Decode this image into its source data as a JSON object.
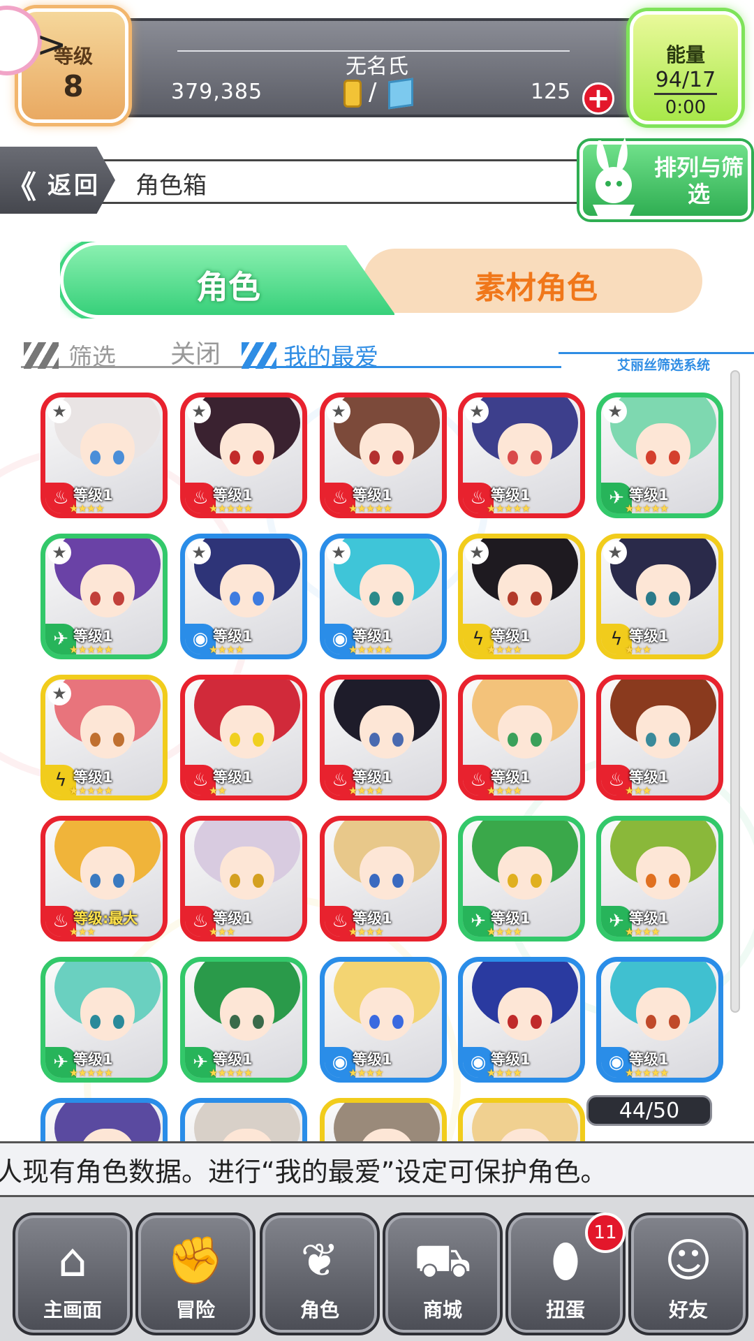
{
  "status": {
    "level_label": "等级",
    "level_value": "8",
    "username": "无名氏",
    "gold": "379,385",
    "currency_separator": "/",
    "gems": "125",
    "add_symbol": "+",
    "energy_label": "能量",
    "energy_value": "94/17",
    "energy_timer": "0:00",
    "collapse_symbol": ">"
  },
  "header": {
    "back_icon": "《",
    "back_label": "返回",
    "title": "角色箱",
    "sort_filter_label": "排列与筛选"
  },
  "tabs": {
    "characters": "角色",
    "materials": "素材角色"
  },
  "filter_row": {
    "filter_label": "筛选",
    "filter_state": "关闭",
    "favorites_label": "我的最爱",
    "system_caption": "艾丽丝筛选系统"
  },
  "box_count": "44/50",
  "grid": {
    "cards": [
      {
        "frame": "red",
        "element_icon": "fire-icon",
        "element_glyph": "♨",
        "favorite": true,
        "level": "等级1",
        "rarity": 4,
        "hair": "#e9e4e4",
        "eye": "#4b8ed8"
      },
      {
        "frame": "red",
        "element_icon": "fire-icon",
        "element_glyph": "♨",
        "favorite": true,
        "level": "等级1",
        "rarity": 5,
        "hair": "#3a2230",
        "eye": "#c22a2a"
      },
      {
        "frame": "red",
        "element_icon": "fire-icon",
        "element_glyph": "♨",
        "favorite": true,
        "level": "等级1",
        "rarity": 5,
        "hair": "#7c4a3a",
        "eye": "#b43030"
      },
      {
        "frame": "red",
        "element_icon": "fire-icon",
        "element_glyph": "♨",
        "favorite": true,
        "level": "等级1",
        "rarity": 5,
        "hair": "#3d3f8c",
        "eye": "#d94a4a"
      },
      {
        "frame": "green",
        "element_icon": "wind-icon",
        "element_glyph": "✈",
        "favorite": true,
        "level": "等级1",
        "rarity": 5,
        "hair": "#7ed8b0",
        "eye": "#d4402e"
      },
      {
        "frame": "green",
        "element_icon": "wind-icon",
        "element_glyph": "✈",
        "favorite": true,
        "level": "等级1",
        "rarity": 5,
        "hair": "#6a42a6",
        "eye": "#c2403a"
      },
      {
        "frame": "blue",
        "element_icon": "water-icon",
        "element_glyph": "◉",
        "favorite": true,
        "level": "等级1",
        "rarity": 4,
        "hair": "#2e3478",
        "eye": "#3e7ce0"
      },
      {
        "frame": "blue",
        "element_icon": "water-icon",
        "element_glyph": "◉",
        "favorite": true,
        "level": "等级1",
        "rarity": 5,
        "hair": "#3fc5d8",
        "eye": "#2a8a8a"
      },
      {
        "frame": "yellow",
        "element_icon": "lightning-icon",
        "element_glyph": "ϟ",
        "favorite": true,
        "level": "等级1",
        "rarity": 4,
        "hair": "#1e1a20",
        "eye": "#b23a2a"
      },
      {
        "frame": "yellow",
        "element_icon": "lightning-icon",
        "element_glyph": "ϟ",
        "favorite": true,
        "level": "等级1",
        "rarity": 3,
        "hair": "#2a2a4a",
        "eye": "#2a7a8a"
      },
      {
        "frame": "yellow",
        "element_icon": "lightning-icon",
        "element_glyph": "ϟ",
        "favorite": true,
        "level": "等级1",
        "rarity": 5,
        "hair": "#e8747c",
        "eye": "#c07030"
      },
      {
        "frame": "red",
        "element_icon": "fire-icon",
        "element_glyph": "♨",
        "favorite": false,
        "level": "等级1",
        "rarity": 2,
        "hair": "#d12a3a",
        "eye": "#f0d020"
      },
      {
        "frame": "red",
        "element_icon": "fire-icon",
        "element_glyph": "♨",
        "favorite": false,
        "level": "等级1",
        "rarity": 4,
        "hair": "#1e1c2a",
        "eye": "#4a6ab0"
      },
      {
        "frame": "red",
        "element_icon": "fire-icon",
        "element_glyph": "♨",
        "favorite": false,
        "level": "等级1",
        "rarity": 4,
        "hair": "#f3c27a",
        "eye": "#3aa05a"
      },
      {
        "frame": "red",
        "element_icon": "fire-icon",
        "element_glyph": "♨",
        "favorite": false,
        "level": "等级1",
        "rarity": 3,
        "hair": "#8a3a1e",
        "eye": "#3a8a9a"
      },
      {
        "frame": "red",
        "element_icon": "fire-icon",
        "element_glyph": "♨",
        "favorite": false,
        "level": "等级:最大",
        "level_max": true,
        "rarity": 3,
        "hair": "#f0b43a",
        "eye": "#3a7ac0"
      },
      {
        "frame": "red",
        "element_icon": "fire-icon",
        "element_glyph": "♨",
        "favorite": false,
        "level": "等级1",
        "rarity": 3,
        "hair": "#d8cbe0",
        "eye": "#d4a020"
      },
      {
        "frame": "red",
        "element_icon": "fire-icon",
        "element_glyph": "♨",
        "favorite": false,
        "level": "等级1",
        "rarity": 4,
        "hair": "#e8c88a",
        "eye": "#3a6ac0"
      },
      {
        "frame": "green",
        "element_icon": "wind-icon",
        "element_glyph": "✈",
        "favorite": false,
        "level": "等级1",
        "rarity": 4,
        "hair": "#3aa84a",
        "eye": "#e0b020"
      },
      {
        "frame": "green",
        "element_icon": "wind-icon",
        "element_glyph": "✈",
        "favorite": false,
        "level": "等级1",
        "rarity": 4,
        "hair": "#8ab83a",
        "eye": "#e07020"
      },
      {
        "frame": "green",
        "element_icon": "wind-icon",
        "element_glyph": "✈",
        "favorite": false,
        "level": "等级1",
        "rarity": 5,
        "hair": "#6ad0c0",
        "eye": "#2a8a9a"
      },
      {
        "frame": "green",
        "element_icon": "wind-icon",
        "element_glyph": "✈",
        "favorite": false,
        "level": "等级1",
        "rarity": 5,
        "hair": "#2a9a4a",
        "eye": "#3a6a4a"
      },
      {
        "frame": "blue",
        "element_icon": "water-icon",
        "element_glyph": "◉",
        "favorite": false,
        "level": "等级1",
        "rarity": 4,
        "hair": "#f3d472",
        "eye": "#3a6ae0"
      },
      {
        "frame": "blue",
        "element_icon": "water-icon",
        "element_glyph": "◉",
        "favorite": false,
        "level": "等级1",
        "rarity": 4,
        "hair": "#2a3aa0",
        "eye": "#c02a2a"
      },
      {
        "frame": "blue",
        "element_icon": "water-icon",
        "element_glyph": "◉",
        "favorite": false,
        "level": "等级1",
        "rarity": 5,
        "hair": "#40c0d0",
        "eye": "#c04a2a"
      },
      {
        "frame": "blue",
        "element_icon": "water-icon",
        "element_glyph": "◉",
        "favorite": false,
        "partial": true,
        "hair": "#5a4aa0",
        "eye": "#444"
      },
      {
        "frame": "blue",
        "element_icon": "water-icon",
        "element_glyph": "◉",
        "favorite": false,
        "partial": true,
        "hair": "#d8d0c8",
        "eye": "#444"
      },
      {
        "frame": "yellow",
        "element_icon": "lightning-icon",
        "element_glyph": "ϟ",
        "favorite": false,
        "partial": true,
        "hair": "#9a8a7a",
        "eye": "#444"
      },
      {
        "frame": "yellow",
        "element_icon": "lightning-icon",
        "element_glyph": "ϟ",
        "favorite": false,
        "partial": true,
        "hair": "#f0d090",
        "eye": "#444"
      }
    ]
  },
  "ticker": "人现有角色数据。进行“我的最爱”设定可保护角色。",
  "nav": [
    {
      "label": "主画面",
      "icon": "home-icon",
      "glyph": "⌂"
    },
    {
      "label": "冒险",
      "icon": "handshake-icon",
      "glyph": "✊"
    },
    {
      "label": "角色",
      "icon": "bunny-icon",
      "glyph": "❦"
    },
    {
      "label": "商城",
      "icon": "cart-icon",
      "glyph": "⛟"
    },
    {
      "label": "扭蛋",
      "icon": "egg-icon",
      "glyph": "⬮"
    },
    {
      "label": "好友",
      "icon": "friends-icon",
      "glyph": "☺"
    }
  ],
  "gacha_badge": "11",
  "colors": {
    "fire": "#e8222e",
    "wind": "#33c86a",
    "water": "#2a8de8",
    "lightning": "#f1cc1c",
    "accent_green": "#37d07a",
    "accent_orange": "#f0771a",
    "accent_blue": "#2f8de4"
  }
}
